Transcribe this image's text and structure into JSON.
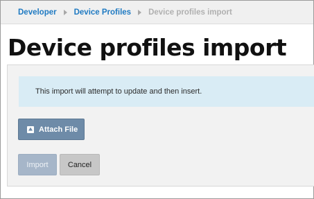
{
  "breadcrumb": {
    "items": [
      {
        "label": "Developer"
      },
      {
        "label": "Device Profiles"
      },
      {
        "label": "Device profiles import"
      }
    ]
  },
  "page": {
    "title": "Device profiles import"
  },
  "info_message": "This import will attempt to update and then insert.",
  "actions": {
    "attach_label": "Attach File",
    "attach_icon": "paperclip-icon",
    "import_label": "Import",
    "cancel_label": "Cancel"
  },
  "colors": {
    "link": "#1f7ac2",
    "info_bg": "#d9ecf5",
    "attach_button": "#6e8ba8",
    "import_disabled": "#a6b6c9",
    "cancel_button": "#c7c7c7"
  }
}
